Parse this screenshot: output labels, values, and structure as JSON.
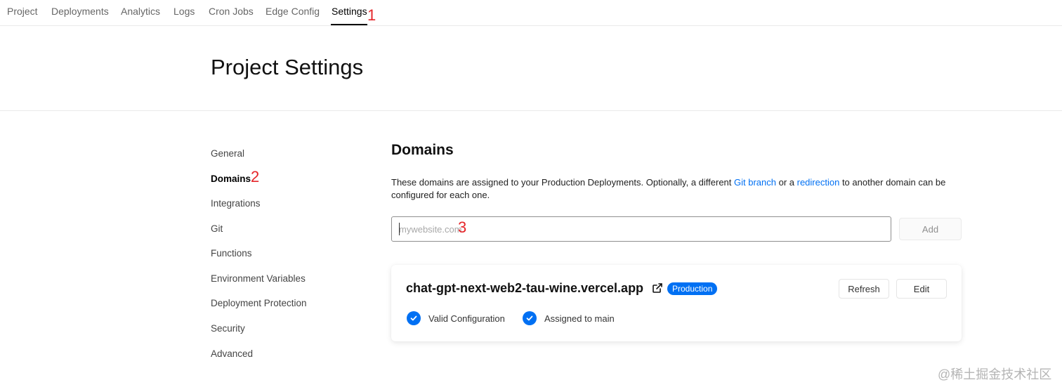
{
  "topnav": {
    "tabs": [
      {
        "label": "Project"
      },
      {
        "label": "Deployments"
      },
      {
        "label": "Analytics"
      },
      {
        "label": "Logs"
      },
      {
        "label": "Cron Jobs"
      },
      {
        "label": "Edge Config"
      },
      {
        "label": "Settings",
        "active": true
      }
    ]
  },
  "annotations": {
    "a1": "1",
    "a2": "2",
    "a3": "3"
  },
  "header": {
    "title": "Project Settings"
  },
  "sidebar": {
    "items": [
      {
        "label": "General"
      },
      {
        "label": "Domains",
        "active": true
      },
      {
        "label": "Integrations"
      },
      {
        "label": "Git"
      },
      {
        "label": "Functions"
      },
      {
        "label": "Environment Variables"
      },
      {
        "label": "Deployment Protection"
      },
      {
        "label": "Security"
      },
      {
        "label": "Advanced"
      }
    ]
  },
  "domains": {
    "title": "Domains",
    "description": {
      "part1": "These domains are assigned to your Production Deployments. Optionally, a different ",
      "link1": "Git branch",
      "part2": " or a ",
      "link2": "redirection",
      "part3": " to another domain can be configured for each one."
    },
    "input": {
      "placeholder": "mywebsite.com",
      "value": ""
    },
    "add_label": "Add",
    "card": {
      "domain": "chat-gpt-next-web2-tau-wine.vercel.app",
      "badge": "Production",
      "refresh_label": "Refresh",
      "edit_label": "Edit",
      "status1": "Valid Configuration",
      "status2": "Assigned to main"
    }
  },
  "watermark": "@稀土掘金技术社区",
  "colors": {
    "accent": "#0070f3",
    "annotation": "#e5262a",
    "border": "#eaeaea"
  },
  "icons": [
    "external-link-icon",
    "check-circle-icon"
  ]
}
